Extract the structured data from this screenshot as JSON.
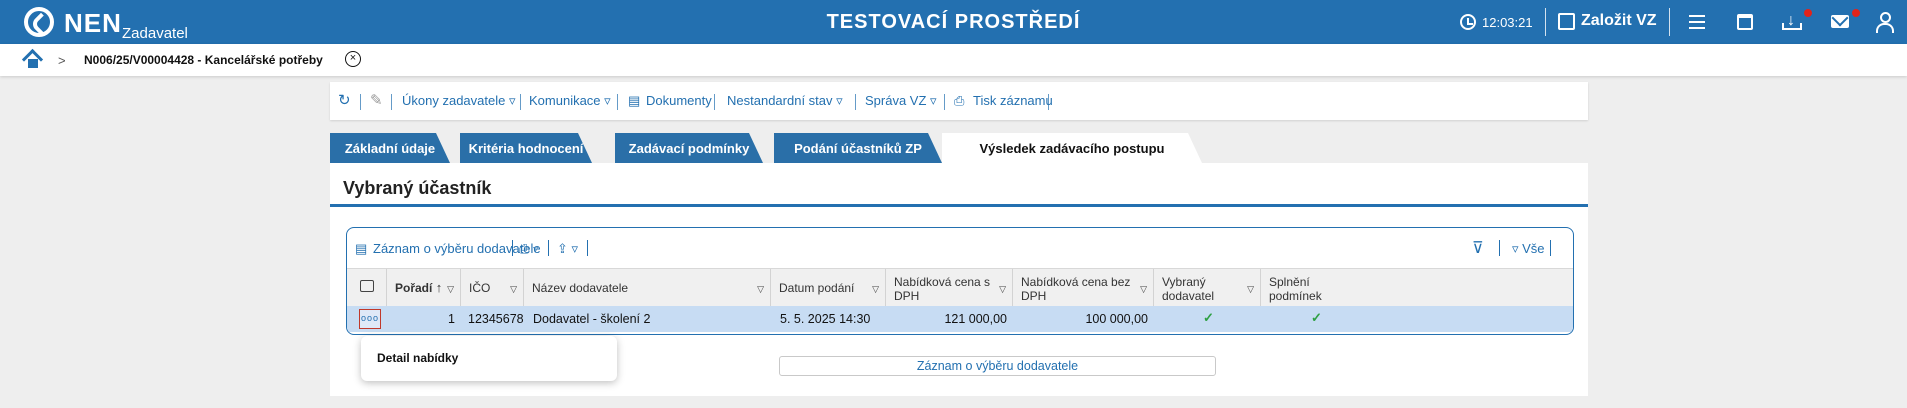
{
  "topbar": {
    "logo_text": "NEN",
    "logo_sub": "Zadavatel",
    "title": "TESTOVACÍ PROSTŘEDÍ",
    "clock": "12:03:21",
    "create_label": "Založit VZ",
    "colors": {
      "bar": "#2370b0",
      "badge": "#e2231a"
    }
  },
  "breadcrumb": {
    "chevron": ">",
    "text": "N006/25/V00004428 - Kancelářské potřeby",
    "close": "×"
  },
  "actions": {
    "refresh": "↻",
    "edit": "✎",
    "ukony": "Úkony zadavatele ▿",
    "komunikace": "Komunikace ▿",
    "dokumenty": "Dokumenty",
    "nestandardni": "Nestandardní stav ▿",
    "sprava": "Správa VZ ▿",
    "tisk": "Tisk záznamu"
  },
  "tabs": [
    {
      "label": "Základní údaje"
    },
    {
      "label": "Kritéria hodnocení"
    },
    {
      "label": "Zadávací podmínky"
    },
    {
      "label": "Podání účastníků ZP"
    },
    {
      "label": "Výsledek zadávacího postupu"
    }
  ],
  "panel": {
    "title": "Vybraný účastník"
  },
  "grid_toolbar": {
    "record": "Záznam o výběru dodavatele",
    "print": "⎙ ▿",
    "export": "⇪ ▿",
    "filter": "⊽",
    "all": "▿ Vše"
  },
  "columns": {
    "poradi": "Pořadí",
    "ico": "IČO",
    "nazev": "Název dodavatele",
    "datum": "Datum podání",
    "cena_s1": "Nabídková cena s",
    "cena_s2": "DPH",
    "cena_bez1": "Nabídková cena bez",
    "cena_bez2": "DPH",
    "vybrany1": "Vybraný",
    "vybrany2": "dodavatel",
    "splneni1": "Splnění",
    "splneni2": "podmínek"
  },
  "row": {
    "dots": "ooo",
    "poradi": "1",
    "ico": "12345678",
    "nazev": "Dodavatel - školení 2",
    "datum": "5. 5. 2025 14:30",
    "cena_s": "121 000,00",
    "cena_bez": "100 000,00",
    "vybrany": "✓",
    "splneni": "✓"
  },
  "popup": {
    "item": "Detail nabídky"
  },
  "bottom_button": "Záznam o výběru dodavatele"
}
